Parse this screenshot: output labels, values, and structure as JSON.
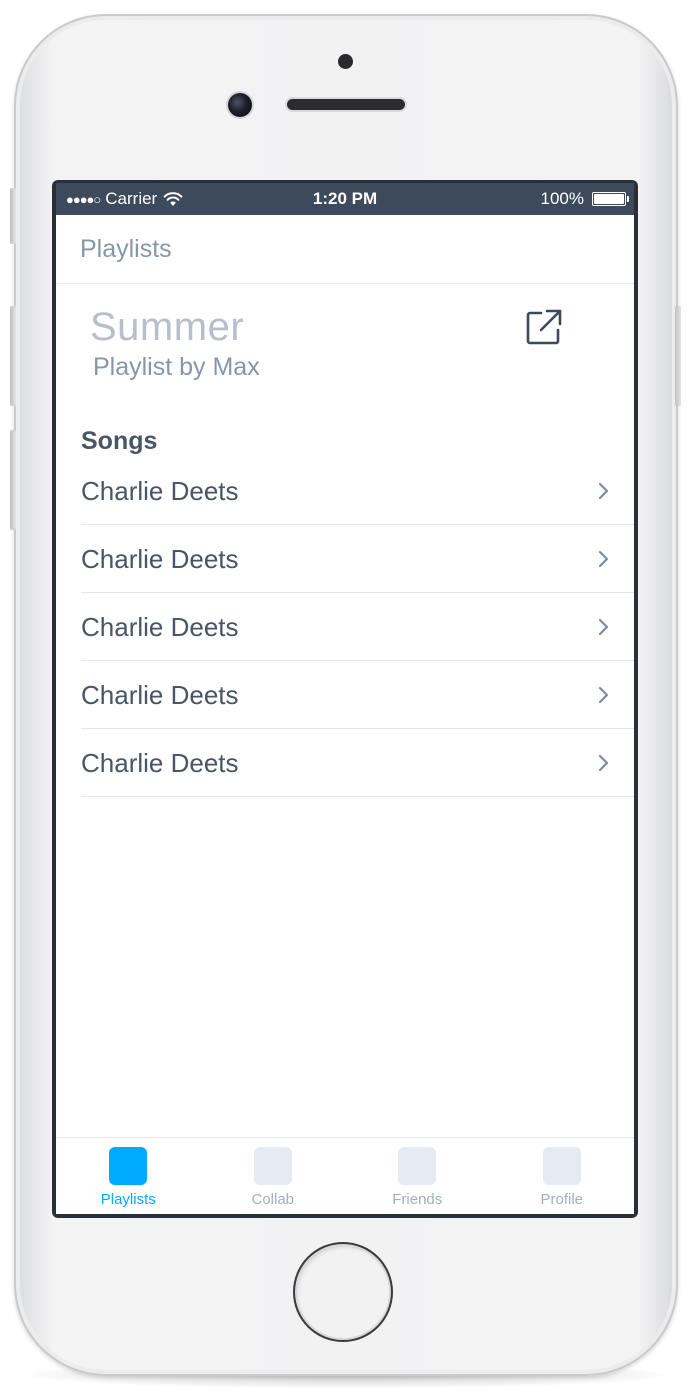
{
  "status_bar": {
    "signal": "●●●●○",
    "carrier": "Carrier",
    "time": "1:20 PM",
    "battery": "100%"
  },
  "nav": {
    "title": "Playlists"
  },
  "playlist": {
    "title": "Summer",
    "subtitle": "Playlist by Max",
    "share_icon": "share-external-icon"
  },
  "songs": {
    "header": "Songs",
    "items": [
      {
        "title": "Charlie Deets"
      },
      {
        "title": "Charlie Deets"
      },
      {
        "title": "Charlie Deets"
      },
      {
        "title": "Charlie Deets"
      },
      {
        "title": "Charlie Deets"
      }
    ]
  },
  "tabs": [
    {
      "label": "Playlists",
      "active": true
    },
    {
      "label": "Collab",
      "active": false
    },
    {
      "label": "Friends",
      "active": false
    },
    {
      "label": "Profile",
      "active": false
    }
  ],
  "colors": {
    "accent": "#00aaff",
    "status_bar": "#3c4a5b",
    "icon_dark": "#3d4a5c",
    "text_muted": "#8896aa",
    "text_primary": "#4a5566"
  }
}
